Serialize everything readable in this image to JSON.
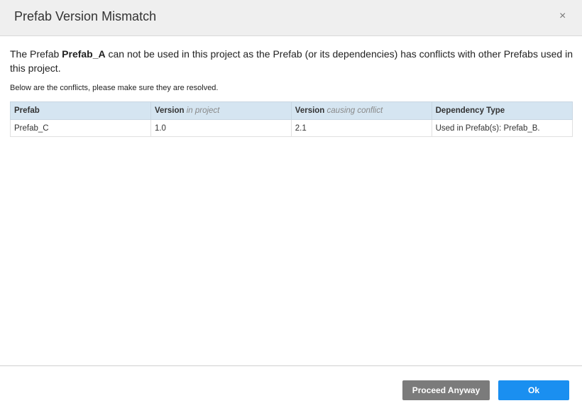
{
  "dialog": {
    "title": "Prefab Version Mismatch",
    "close_icon": "×",
    "message_prefix": "The Prefab ",
    "message_prefab": "Prefab_A",
    "message_suffix": " can not be used in this project as the Prefab (or its dependencies) has conflicts with other Prefabs used in this project.",
    "subtext": "Below are the conflicts, please make sure they are resolved."
  },
  "table": {
    "headers": [
      {
        "main": "Prefab",
        "em": ""
      },
      {
        "main": "Version ",
        "em": "in project"
      },
      {
        "main": "Version ",
        "em": "causing conflict"
      },
      {
        "main": "Dependency Type",
        "em": ""
      }
    ],
    "rows": [
      [
        "Prefab_C",
        "1.0",
        "2.1",
        "Used in Prefab(s): Prefab_B."
      ]
    ]
  },
  "footer": {
    "proceed_label": "Proceed Anyway",
    "ok_label": "Ok"
  },
  "colors": {
    "ok": "#1a8ff0",
    "proceed": "#7b7b7b",
    "table_header": "#d5e5f1"
  }
}
